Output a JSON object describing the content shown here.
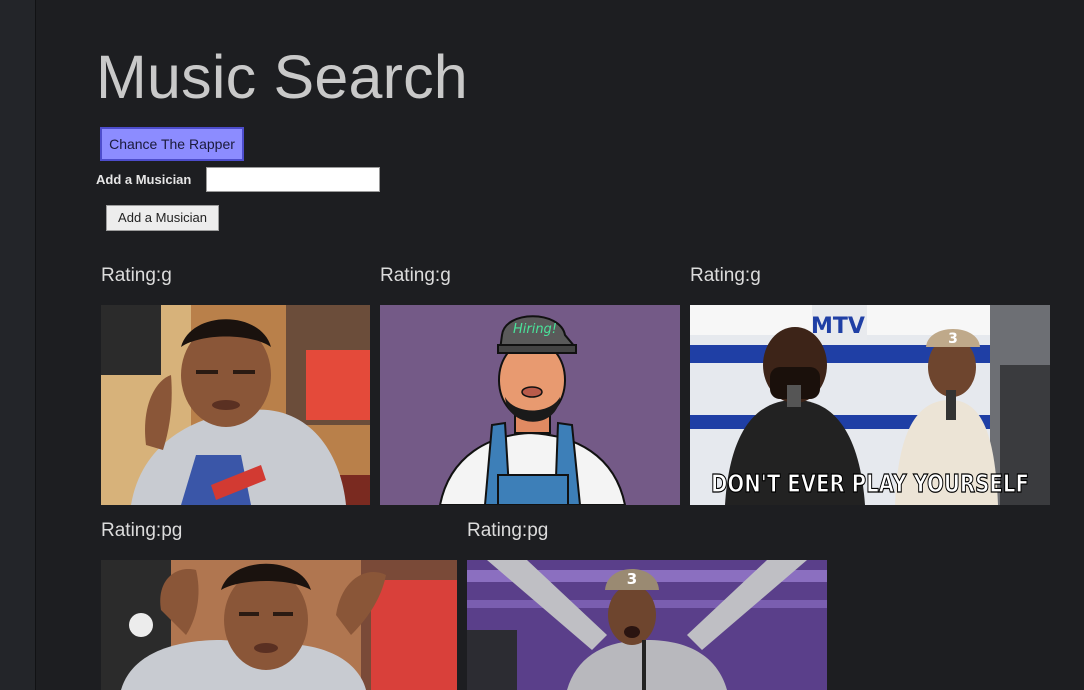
{
  "header": {
    "title": "Music Search"
  },
  "artists": [
    {
      "label": "Chance The Rapper"
    }
  ],
  "add_form": {
    "label": "Add a Musician",
    "input_value": "",
    "button_label": "Add a Musician"
  },
  "gifs": [
    {
      "rating_label": "Rating:g",
      "caption": ""
    },
    {
      "rating_label": "Rating:g",
      "caption": "Hiring!"
    },
    {
      "rating_label": "Rating:g",
      "caption": "DON'T EVER PLAY YOURSELF",
      "logo": "MTV",
      "cap_number": "3"
    },
    {
      "rating_label": "Rating:pg",
      "caption": ""
    },
    {
      "rating_label": "Rating:pg",
      "caption": "",
      "cap_number": "3"
    }
  ],
  "colors": {
    "background": "#1d1e21",
    "artist_button": "#8c8cff",
    "title_text": "#c9c9c9"
  }
}
